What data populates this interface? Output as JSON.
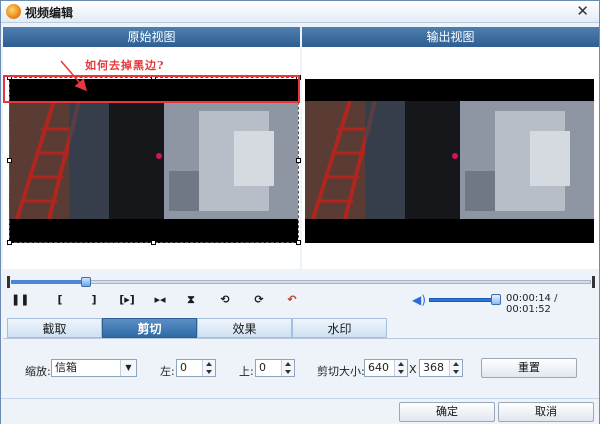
{
  "window": {
    "title": "视频编辑",
    "close_glyph": "✕"
  },
  "views": {
    "original_label": "原始视图",
    "output_label": "输出视图"
  },
  "annotation": {
    "text": "如何去掉黑边?"
  },
  "timeline": {
    "progress_fraction": 0.13
  },
  "volume": {
    "level_fraction": 1.0
  },
  "playback": {
    "buttons": [
      {
        "name": "pause-icon",
        "glyph": "❚❚"
      },
      {
        "name": "mark-in-icon",
        "glyph": "["
      },
      {
        "name": "mark-out-icon",
        "glyph": "]"
      },
      {
        "name": "play-segment-icon",
        "glyph": "[▸]"
      },
      {
        "name": "split-icon",
        "glyph": "▸◂"
      },
      {
        "name": "flip-vertical-icon",
        "glyph": "⧗"
      },
      {
        "name": "rotate-left-icon",
        "glyph": "⟲"
      },
      {
        "name": "rotate-right-icon",
        "glyph": "⟳"
      },
      {
        "name": "undo-icon",
        "glyph": "↶"
      }
    ],
    "time_display": "00:00:14 / 00:01:52"
  },
  "tabs": [
    {
      "label": "截取",
      "active": false
    },
    {
      "label": "剪切",
      "active": true
    },
    {
      "label": "效果",
      "active": false
    },
    {
      "label": "水印",
      "active": false
    }
  ],
  "crop": {
    "zoom_label": "缩放:",
    "zoom_value": "信箱",
    "left_label": "左:",
    "left_value": "0",
    "top_label": "上:",
    "top_value": "0",
    "size_label": "剪切大小:",
    "width_value": "640",
    "times_label": "X",
    "height_value": "368",
    "reset_label": "重置"
  },
  "footer": {
    "ok_label": "确定",
    "cancel_label": "取消"
  },
  "colors": {
    "accent": "#2f6aa5",
    "annotation": "#e8373a",
    "header": "#3d6e9f"
  }
}
